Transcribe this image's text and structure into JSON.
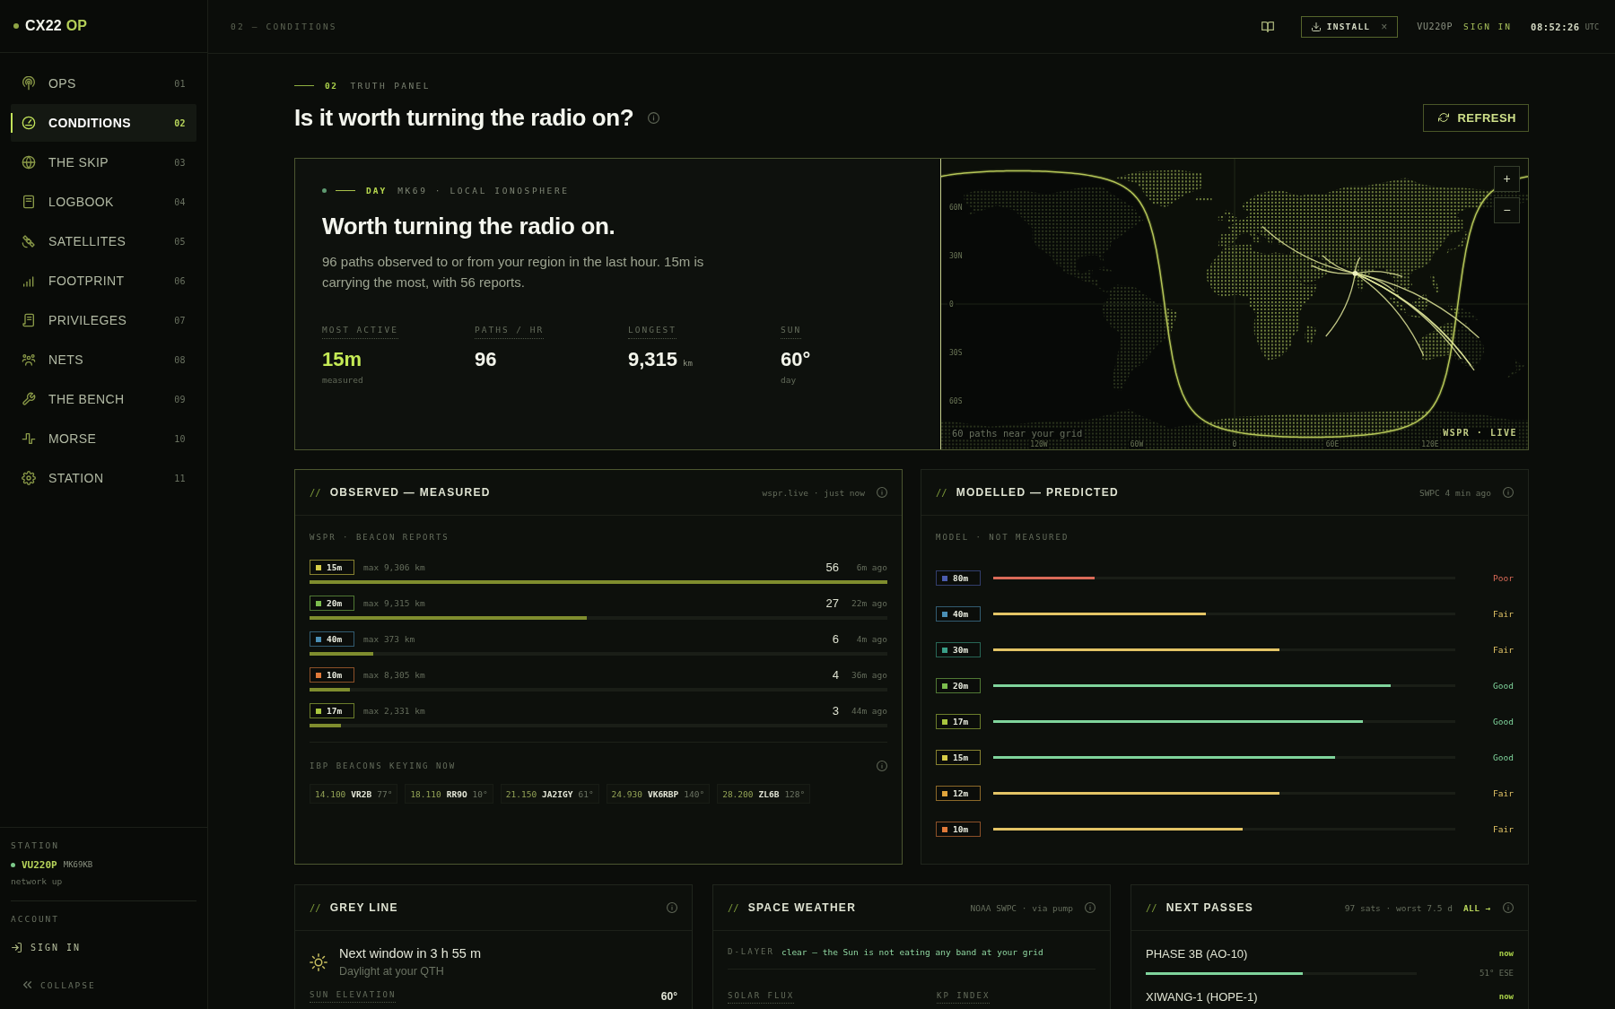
{
  "brand": {
    "name": "CX22",
    "suffix": "OP"
  },
  "sidebar": {
    "items": [
      {
        "label": "OPS",
        "number": "01",
        "selected": false
      },
      {
        "label": "CONDITIONS",
        "number": "02",
        "selected": true
      },
      {
        "label": "THE SKIP",
        "number": "03",
        "selected": false
      },
      {
        "label": "LOGBOOK",
        "number": "04",
        "selected": false
      },
      {
        "label": "SATELLITES",
        "number": "05",
        "selected": false
      },
      {
        "label": "FOOTPRINT",
        "number": "06",
        "selected": false
      },
      {
        "label": "PRIVILEGES",
        "number": "07",
        "selected": false
      },
      {
        "label": "NETS",
        "number": "08",
        "selected": false
      },
      {
        "label": "THE BENCH",
        "number": "09",
        "selected": false
      },
      {
        "label": "MORSE",
        "number": "10",
        "selected": false
      },
      {
        "label": "STATION",
        "number": "11",
        "selected": false
      }
    ],
    "station": {
      "heading": "STATION",
      "callsign": "VU220P",
      "grid": "MK69KB",
      "status": "network up"
    },
    "account": {
      "heading": "ACCOUNT",
      "action": "SIGN IN"
    },
    "collapse": "COLLAPSE"
  },
  "top_bar": {
    "breadcrumb": "02 — CONDITIONS",
    "install": "INSTALL",
    "dismiss": "×",
    "callsign": "VU220P",
    "sign_in": "SIGN IN",
    "time": "08:52:26",
    "zone": "UTC"
  },
  "page": {
    "number": "02",
    "kicker": "TRUTH PANEL",
    "title": "Is it worth turning the radio on?",
    "refresh": "REFRESH"
  },
  "hero": {
    "phase": "DAY",
    "location": "MK69 · LOCAL IONOSPHERE",
    "headline": "Worth turning the radio on.",
    "summary": "96 paths observed to or from your region in the last hour. 15m is carrying the most, with 56 reports.",
    "stats": [
      {
        "label": "MOST ACTIVE",
        "value": "15m",
        "note": "measured",
        "highlight": true
      },
      {
        "label": "PATHS / HR",
        "value": "96",
        "highlight": false
      },
      {
        "label": "LONGEST",
        "value": "9,315",
        "unit": "km",
        "highlight": false
      },
      {
        "label": "SUN",
        "value": "60°",
        "note": "day",
        "highlight": false
      }
    ]
  },
  "map": {
    "zoom_in": "+",
    "zoom_out": "−",
    "caption": "60 paths near your grid",
    "source": "WSPR · LIVE",
    "lat_labels": [
      "60N",
      "30N",
      "0",
      "30S",
      "60S"
    ],
    "lon_labels": [
      "120W",
      "60W",
      "0",
      "60E",
      "120E"
    ]
  },
  "observed": {
    "prefix": "//",
    "title": "OBSERVED — MEASURED",
    "meta": "wspr.live · just now",
    "highlighted": true,
    "subtitle": "WSPR · BEACON REPORTS",
    "bands": [
      {
        "band": "15m",
        "color": "#d6cc48",
        "max": "max 9,306 km",
        "count": "56",
        "age": "6m ago",
        "level": 1
      },
      {
        "band": "20m",
        "color": "#7cbd4e",
        "max": "max 9,315 km",
        "count": "27",
        "age": "22m ago",
        "level": 0.48
      },
      {
        "band": "40m",
        "color": "#4b8fb5",
        "max": "max 373 km",
        "count": "6",
        "age": "4m ago",
        "level": 0.11
      },
      {
        "band": "10m",
        "color": "#e07a3a",
        "max": "max 8,305 km",
        "count": "4",
        "age": "36m ago",
        "level": 0.07
      },
      {
        "band": "17m",
        "color": "#a9c63f",
        "max": "max 2,331 km",
        "count": "3",
        "age": "44m ago",
        "level": 0.055
      }
    ],
    "beacons_title": "IBP BEACONS KEYING NOW",
    "beacons": [
      {
        "freq": "14.100",
        "call": "VR2B",
        "bearing": "77°"
      },
      {
        "freq": "18.110",
        "call": "RR9O",
        "bearing": "10°"
      },
      {
        "freq": "21.150",
        "call": "JA2IGY",
        "bearing": "61°"
      },
      {
        "freq": "24.930",
        "call": "VK6RBP",
        "bearing": "140°"
      },
      {
        "freq": "28.200",
        "call": "ZL6B",
        "bearing": "128°"
      }
    ]
  },
  "modelled": {
    "prefix": "//",
    "title": "MODELLED — PREDICTED",
    "meta": "SWPC 4 min ago",
    "highlighted": false,
    "subtitle": "MODEL · NOT MEASURED",
    "bands": [
      {
        "band": "80m",
        "color": "#4b5cae",
        "level": 0.22,
        "rating": "Poor",
        "kind": "poor"
      },
      {
        "band": "40m",
        "color": "#4b8fb5",
        "level": 0.46,
        "rating": "Fair",
        "kind": "fair"
      },
      {
        "band": "30m",
        "color": "#3a9f88",
        "level": 0.62,
        "rating": "Fair",
        "kind": "fair"
      },
      {
        "band": "20m",
        "color": "#7cbd4e",
        "level": 0.86,
        "rating": "Good",
        "kind": "good"
      },
      {
        "band": "17m",
        "color": "#a9c63f",
        "level": 0.8,
        "rating": "Good",
        "kind": "good"
      },
      {
        "band": "15m",
        "color": "#d6cc48",
        "level": 0.74,
        "rating": "Good",
        "kind": "good"
      },
      {
        "band": "12m",
        "color": "#e0a53c",
        "level": 0.62,
        "rating": "Fair",
        "kind": "fair"
      },
      {
        "band": "10m",
        "color": "#e07a3a",
        "level": 0.54,
        "rating": "Fair",
        "kind": "fair"
      }
    ]
  },
  "grey_line": {
    "prefix": "//",
    "title": "GREY LINE",
    "next": "Next window in 3 h 55 m",
    "detail": "Daylight at your QTH",
    "metric_label": "SUN ELEVATION",
    "metric_value": "60°"
  },
  "space_weather": {
    "prefix": "//",
    "title": "SPACE WEATHER",
    "meta": "NOAA SWPC · via pump",
    "layer_label": "D-LAYER",
    "layer_text": "clear — the Sun is not eating any band at your grid",
    "metrics": [
      "SOLAR FLUX",
      "KP INDEX"
    ]
  },
  "next_passes": {
    "prefix": "//",
    "title": "NEXT PASSES",
    "meta": "97 sats · worst 7.5 d",
    "all_link": "ALL →",
    "passes": [
      {
        "name": "PHASE 3B (AO-10)",
        "when": "now",
        "level": 0.58,
        "position": "51° ESE"
      },
      {
        "name": "XIWANG-1 (HOPE-1)",
        "when": "now"
      }
    ]
  }
}
